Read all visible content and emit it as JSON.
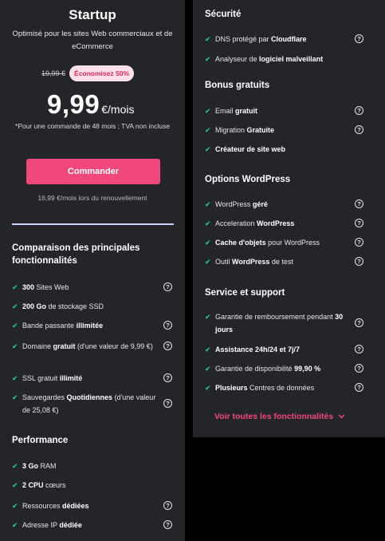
{
  "plan": {
    "title": "Startup",
    "description": "Optimisé pour les sites Web commerciaux et de eCommerce",
    "old_price": "19,99 €",
    "discount": "Économisez 50%",
    "price": "9,99",
    "price_unit": "€/mois",
    "price_note": "*Pour une commande de 48 mois ; TVA non incluse",
    "order_label": "Commander",
    "renewal": "16,99 €/mois lors du renouvellement"
  },
  "comparison": {
    "title": "Comparaison des principales fonctionnalités",
    "items": [
      {
        "parts": [
          {
            "t": "300",
            "b": true
          },
          {
            "t": " Sites Web",
            "b": false
          }
        ],
        "help": true
      },
      {
        "parts": [
          {
            "t": "200 Go",
            "b": true
          },
          {
            "t": " de stockage SSD",
            "b": false
          }
        ],
        "help": false
      },
      {
        "parts": [
          {
            "t": "Bande passante ",
            "b": false
          },
          {
            "t": "illimitée",
            "b": true
          }
        ],
        "help": true
      },
      {
        "parts": [
          {
            "t": "Domaine ",
            "b": false
          },
          {
            "t": "gratuit",
            "b": true
          },
          {
            "t": " (d'une valeur de 9,99 €)",
            "b": false
          }
        ],
        "help": true
      },
      {
        "parts": [
          {
            "t": "SSL gratuit ",
            "b": false
          },
          {
            "t": "illimité",
            "b": true
          }
        ],
        "help": true
      },
      {
        "parts": [
          {
            "t": "Sauvegardes ",
            "b": false
          },
          {
            "t": "Quotidiennes",
            "b": true
          },
          {
            "t": " (d'une valeur de 25,08 €)",
            "b": false
          }
        ],
        "help": true
      }
    ]
  },
  "performance": {
    "title": "Performance",
    "items": [
      {
        "parts": [
          {
            "t": "3 Go",
            "b": true
          },
          {
            "t": " RAM",
            "b": false
          }
        ],
        "help": false
      },
      {
        "parts": [
          {
            "t": "2 CPU",
            "b": true
          },
          {
            "t": " cœurs",
            "b": false
          }
        ],
        "help": false
      },
      {
        "parts": [
          {
            "t": "Ressources ",
            "b": false
          },
          {
            "t": "dédiées",
            "b": true
          }
        ],
        "help": true
      },
      {
        "parts": [
          {
            "t": "Adresse IP ",
            "b": false
          },
          {
            "t": "dédiée",
            "b": true
          }
        ],
        "help": true
      }
    ]
  },
  "security": {
    "title": "Sécurité",
    "items": [
      {
        "parts": [
          {
            "t": "DNS protégé par ",
            "b": false
          },
          {
            "t": "Cloudflare",
            "b": true
          }
        ],
        "help": true
      },
      {
        "parts": [
          {
            "t": "Analyseur de ",
            "b": false
          },
          {
            "t": "logiciel malveillant",
            "b": true
          }
        ],
        "help": false
      }
    ]
  },
  "bonus": {
    "title": "Bonus gratuits",
    "items": [
      {
        "parts": [
          {
            "t": "Email ",
            "b": false
          },
          {
            "t": "gratuit",
            "b": true
          }
        ],
        "help": true
      },
      {
        "parts": [
          {
            "t": "Migration ",
            "b": false
          },
          {
            "t": "Gratuite",
            "b": true
          }
        ],
        "help": true
      },
      {
        "parts": [
          {
            "t": "Créateur de site web",
            "b": true
          }
        ],
        "help": false
      }
    ]
  },
  "wordpress": {
    "title": "Options WordPress",
    "items": [
      {
        "parts": [
          {
            "t": "WordPress ",
            "b": false
          },
          {
            "t": "géré",
            "b": true
          }
        ],
        "help": true
      },
      {
        "parts": [
          {
            "t": "Acceleration ",
            "b": false
          },
          {
            "t": "WordPress",
            "b": true
          }
        ],
        "help": true
      },
      {
        "parts": [
          {
            "t": "Cache d'objets",
            "b": true
          },
          {
            "t": " pour WordPress",
            "b": false
          }
        ],
        "help": true
      },
      {
        "parts": [
          {
            "t": "Outil ",
            "b": false
          },
          {
            "t": "WordPress",
            "b": true
          },
          {
            "t": " de test",
            "b": false
          }
        ],
        "help": true
      }
    ]
  },
  "support": {
    "title": "Service et support",
    "items": [
      {
        "parts": [
          {
            "t": "Garantie de remboursement pendant ",
            "b": false
          },
          {
            "t": "30 jours",
            "b": true
          }
        ],
        "help": true
      },
      {
        "parts": [
          {
            "t": "Assistance 24h/24 et 7j/7",
            "b": true
          }
        ],
        "help": true
      },
      {
        "parts": [
          {
            "t": "Garantie de disponibilité ",
            "b": false
          },
          {
            "t": "99,90 %",
            "b": true
          }
        ],
        "help": true
      },
      {
        "parts": [
          {
            "t": "Plusieurs",
            "b": true
          },
          {
            "t": " Centres de données",
            "b": false
          }
        ],
        "help": true
      }
    ]
  },
  "see_all": "Voir toutes les fonctionnalités",
  "icons": {
    "check": "check-icon",
    "help": "help-circle-icon",
    "chevron": "chevron-down-icon"
  },
  "colors": {
    "accent": "#f0487a",
    "check": "#22d49c",
    "card": "#242529"
  }
}
